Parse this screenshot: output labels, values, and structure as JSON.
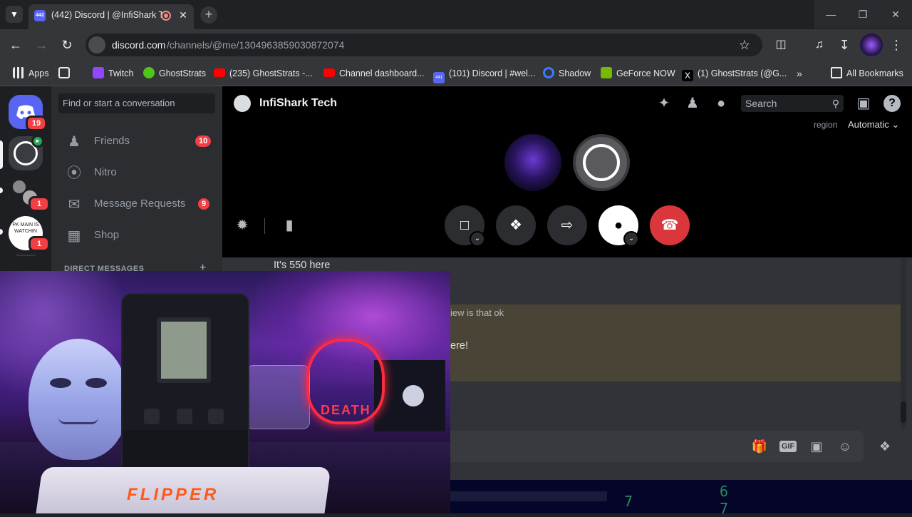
{
  "browser": {
    "tab_title": "(442) Discord | @InfiShark T",
    "tab_badge": "442",
    "url_domain": "discord.com",
    "url_path": "/channels/@me/1304963859030872074",
    "bookmarks": [
      {
        "label": "Apps",
        "color": "#e8eaed"
      },
      {
        "label": "Twitch",
        "color": "#9146ff"
      },
      {
        "label": "GhostStrats",
        "color": "#52c41a"
      },
      {
        "label": "(235) GhostStrats -...",
        "color": "#ff0000"
      },
      {
        "label": "Channel dashboard...",
        "color": "#ff0000"
      },
      {
        "label": "(101) Discord | #wel...",
        "color": "#5865f2"
      },
      {
        "label": "Shadow",
        "color": "#3a7bff"
      },
      {
        "label": "GeForce NOW",
        "color": "#76b900"
      },
      {
        "label": "(1) GhostStrats (@G...",
        "color": "#000000"
      }
    ],
    "all_bookmarks": "All Bookmarks",
    "favicon_badge": "441"
  },
  "guilds": {
    "home_badge": "19",
    "server3_badge": "1",
    "server4_text": "PK MAIN IS WATCHIN",
    "server4_badge": "1"
  },
  "sidebar": {
    "search_placeholder": "Find or start a conversation",
    "items": [
      {
        "label": "Friends",
        "icon": "friends-icon",
        "badge": "10"
      },
      {
        "label": "Nitro",
        "icon": "nitro-icon",
        "badge": ""
      },
      {
        "label": "Message Requests",
        "icon": "mail-icon",
        "badge": "9"
      },
      {
        "label": "Shop",
        "icon": "shop-icon",
        "badge": ""
      }
    ],
    "dm_header": "DIRECT MESSAGES",
    "dm_add": "+"
  },
  "call": {
    "title": "InfiShark Tech",
    "search_placeholder": "Search",
    "region_label": "region",
    "region_value": "Automatic"
  },
  "chat": {
    "message_1": "It's 550 here",
    "message_2": "iew is that ok",
    "message_3": "ere!"
  },
  "composer": {
    "icons": [
      "gift-icon",
      "gif-icon",
      "sticker-icon",
      "emoji-icon",
      "apps-icon"
    ],
    "gif_label": "GIF"
  },
  "webcam": {
    "box_text": "FLIPPER",
    "skull_text": "DEATH"
  },
  "colors": {
    "discord_bg": "#313338",
    "sidebar_bg": "#2b2d31",
    "guilds_bg": "#1e1f22",
    "danger": "#da373c",
    "blurple": "#5865f2"
  }
}
